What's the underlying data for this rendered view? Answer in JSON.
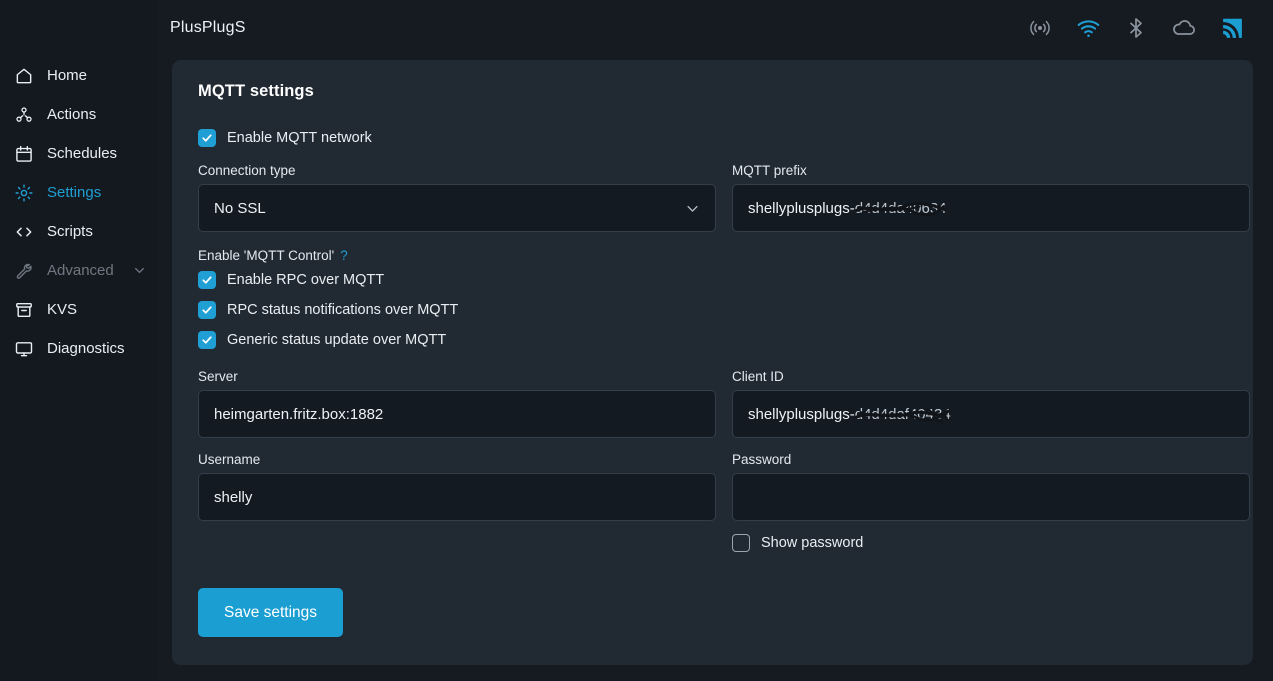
{
  "header": {
    "title": "PlusPlugS",
    "status_icons": [
      {
        "name": "broadcast-icon",
        "label": "Access point",
        "color": "#8b949e"
      },
      {
        "name": "wifi-icon",
        "label": "WiFi",
        "color": "#1f9fd4"
      },
      {
        "name": "bluetooth-icon",
        "label": "Bluetooth",
        "color": "#8b949e"
      },
      {
        "name": "cloud-icon",
        "label": "Cloud",
        "color": "#8b949e"
      },
      {
        "name": "mqtt-icon",
        "label": "MQTT",
        "color": "#1b9ed2"
      }
    ]
  },
  "sidebar": {
    "items": [
      {
        "label": "Home",
        "icon": "home-icon",
        "state": "normal"
      },
      {
        "label": "Actions",
        "icon": "actions-icon",
        "state": "normal"
      },
      {
        "label": "Schedules",
        "icon": "calendar-icon",
        "state": "normal"
      },
      {
        "label": "Settings",
        "icon": "gear-icon",
        "state": "active"
      },
      {
        "label": "Scripts",
        "icon": "code-icon",
        "state": "normal"
      },
      {
        "label": "Advanced",
        "icon": "wrench-icon",
        "state": "dim",
        "chevron": true
      },
      {
        "label": "KVS",
        "icon": "archive-icon",
        "state": "normal"
      },
      {
        "label": "Diagnostics",
        "icon": "monitor-icon",
        "state": "normal"
      }
    ]
  },
  "panel": {
    "title": "MQTT settings",
    "enable_mqtt": {
      "label": "Enable MQTT network",
      "checked": true
    },
    "connection_type": {
      "label": "Connection type",
      "value": "No SSL",
      "options": [
        "No SSL"
      ]
    },
    "mqtt_prefix": {
      "label": "MQTT prefix",
      "value_visible": "shellyplusplugs-",
      "value_redacted": "d4d4da40634"
    },
    "mqtt_control": {
      "label": "Enable 'MQTT Control'",
      "help": "?",
      "checkboxes": [
        {
          "label": "Enable RPC over MQTT",
          "checked": true
        },
        {
          "label": "RPC status notifications over MQTT",
          "checked": true
        },
        {
          "label": "Generic status update over MQTT",
          "checked": true
        }
      ]
    },
    "server": {
      "label": "Server",
      "value": "heimgarten.fritz.box:1882",
      "placeholder": ""
    },
    "client_id": {
      "label": "Client ID",
      "value_visible": "shellyplusplugs-",
      "value_redacted": "d4d4daf40434"
    },
    "username": {
      "label": "Username",
      "value": "shelly",
      "placeholder": ""
    },
    "password": {
      "label": "Password",
      "value": "",
      "placeholder": ""
    },
    "show_password": {
      "label": "Show password",
      "checked": false
    },
    "save_button": "Save settings"
  },
  "colors": {
    "accent": "#1f9fd4",
    "save_button": "#1b9ed2",
    "page_bg": "#161b22",
    "sidebar_bg": "#14191f",
    "panel_bg": "#212932",
    "input_bg": "#141a22"
  }
}
